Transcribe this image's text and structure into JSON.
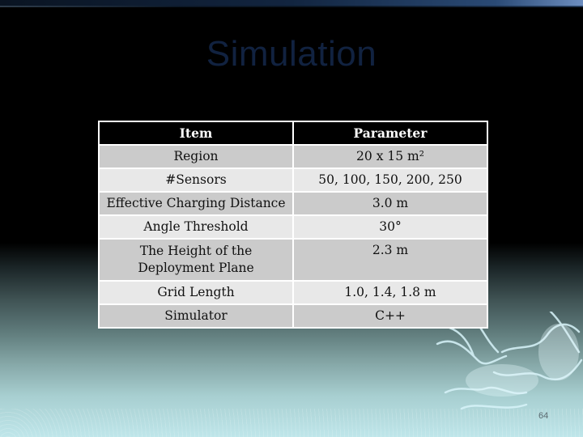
{
  "slide": {
    "title": "Simulation",
    "page_number": "64"
  },
  "table": {
    "headers": [
      "Item",
      "Parameter"
    ],
    "rows": [
      {
        "item": "Region",
        "value": "20 x 15 m²"
      },
      {
        "item": "#Sensors",
        "value": "50, 100, 150, 200, 250"
      },
      {
        "item": "Effective Charging Distance",
        "value": "3.0 m"
      },
      {
        "item": "Angle Threshold",
        "value": "30°"
      },
      {
        "item": "The Height of the Deployment Plane",
        "value": "2.3 m"
      },
      {
        "item": "Grid Length",
        "value": "1.0, 1.4, 1.8 m"
      },
      {
        "item": "Simulator",
        "value": "C++"
      }
    ]
  },
  "decorations": {
    "background-art": "dragon-icon"
  }
}
